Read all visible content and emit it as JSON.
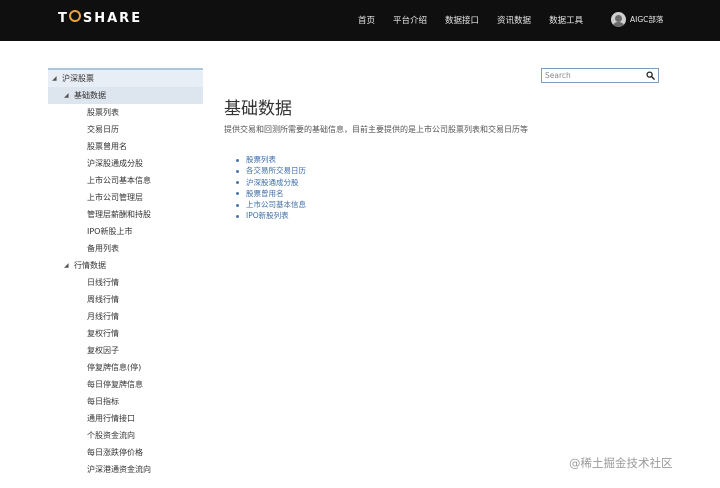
{
  "header": {
    "logo_text_left": "T",
    "logo_text_right": "SHARE",
    "nav": [
      "首页",
      "平台介绍",
      "数据接口",
      "资讯数据",
      "数据工具"
    ],
    "user_name": "AIGC部落"
  },
  "search": {
    "placeholder": "Search"
  },
  "sidebar": {
    "groups": [
      {
        "label": "沪深股票",
        "subgroups": [
          {
            "label": "基础数据",
            "items": [
              "股票列表",
              "交易日历",
              "股票曾用名",
              "沪深股通成分股",
              "上市公司基本信息",
              "上市公司管理层",
              "管理层薪酬和持股",
              "IPO新股上市",
              "备用列表"
            ]
          },
          {
            "label": "行情数据",
            "items": [
              "日线行情",
              "周线行情",
              "月线行情",
              "复权行情",
              "复权因子",
              "停复牌信息(停)",
              "每日停复牌信息",
              "每日指标",
              "通用行情接口",
              "个股资金流向",
              "每日涨跌停价格",
              "沪深港通资金流向"
            ]
          }
        ]
      }
    ]
  },
  "main": {
    "title": "基础数据",
    "description": "提供交易和回测所需要的基础信息，目前主要提供的是上市公司股票列表和交易日历等",
    "links": [
      "股票列表",
      "各交易所交易日历",
      "沪深股通成分股",
      "股票曾用名",
      "上市公司基本信息",
      "IPO新股列表"
    ]
  },
  "watermark": "@稀土掘金技术社区",
  "colors": {
    "topbar_bg": "#0f0f0f",
    "logo_accent": "#e8a33c",
    "link": "#3d6ea8",
    "sidebar_selected": "#dde5ee"
  }
}
